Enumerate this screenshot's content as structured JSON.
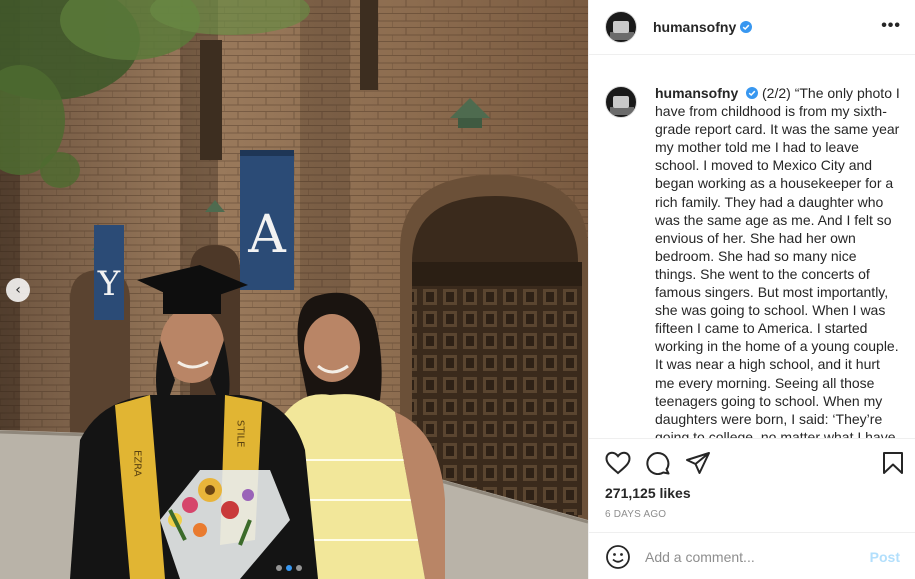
{
  "post": {
    "username": "humansofny",
    "caption": "(2/2) “The only photo I have from childhood is from my sixth-grade report card. It was the same year my mother told me I had to leave school. I moved to Mexico City and began working as a housekeeper for a rich family. They had a daughter who was the same age as me. And I felt so envious of her. She had her own bedroom. She had so many nice things. She went to the concerts of famous singers. But most importantly, she was going to school. When I was fifteen I came to America. I started working in the home of a young couple. It was near a high school, and it hurt me every morning. Seeing all those teenagers going to school. When my daughters were born, I said: ‘They’re going to college, no matter what I have to do.’ I did everything I could.",
    "likes": "271,125 likes",
    "time_ago": "6 DAYS AGO"
  },
  "photo": {
    "banner_left": "Y",
    "banner_right": "A",
    "stole_left": "EZRA",
    "stole_right": "STILE"
  },
  "comment": {
    "placeholder": "Add a comment...",
    "post_label": "Post"
  },
  "icons": {
    "more": "options-icon",
    "like": "heart-icon",
    "comment": "comment-icon",
    "share": "share-icon",
    "save": "bookmark-icon",
    "emoji": "emoji-icon",
    "prev": "chevron-left-icon",
    "verified": "verified-badge-icon"
  },
  "colors": {
    "verified": "#3897f0",
    "post_button_disabled": "#b2dffc",
    "muted_text": "#8e8e8e",
    "border": "#efefef"
  },
  "carousel": {
    "current": 2,
    "total": 3
  }
}
